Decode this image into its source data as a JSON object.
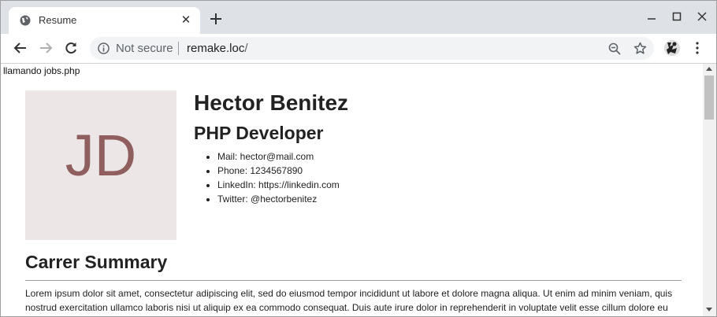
{
  "browser": {
    "tab_title": "Resume",
    "security_label": "Not secure",
    "url_host": "remake.loc",
    "url_path": "/",
    "icons": [
      "globe-icon",
      "close-icon",
      "plus-icon",
      "minimize-icon",
      "maximize-icon",
      "window-close-icon",
      "back-arrow-icon",
      "forward-arrow-icon",
      "reload-icon",
      "info-icon",
      "zoom-out-icon",
      "star-icon",
      "avatar",
      "kebab-menu-icon"
    ]
  },
  "page": {
    "debug_text": "llamando jobs.php",
    "photo_initials": "JD",
    "name": "Hector Benitez",
    "role": "PHP Developer",
    "contacts": [
      "Mail: hector@mail.com",
      "Phone: 1234567890",
      "LinkedIn: https://linkedin.com",
      "Twitter: @hectorbenitez"
    ],
    "summary_title": "Carrer Summary",
    "summary_text": "Lorem ipsum dolor sit amet, consectetur adipiscing elit, sed do eiusmod tempor incididunt ut labore et dolore magna aliqua. Ut enim ad minim veniam, quis nostrud exercitation ullamco laboris nisi ut aliquip ex ea commodo consequat. Duis aute irure dolor in reprehenderit in voluptate velit esse cillum dolore eu"
  },
  "colors": {
    "tabbar": "#dee1e6",
    "photo_bg": "#ede6e6",
    "photo_text": "#8f5e5f"
  }
}
